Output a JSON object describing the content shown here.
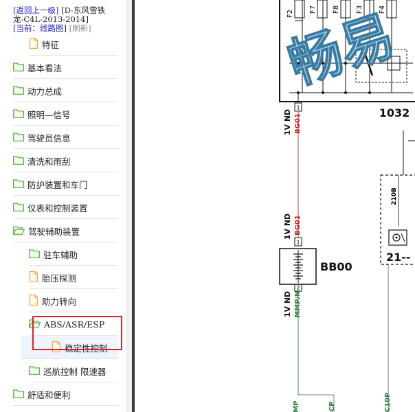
{
  "nav": {
    "back_link": "[返回上一级]",
    "vehicle_line1": "[D-东风雪铁",
    "vehicle_line2": "龙-C4L-2013-2014]",
    "current": "[当前：线路图]",
    "refresh": "[刷新]"
  },
  "tree": {
    "items": [
      {
        "label": "特征",
        "type": "file"
      },
      {
        "label": "基本看法",
        "type": "folder"
      },
      {
        "label": "动力总成",
        "type": "folder"
      },
      {
        "label": "照明—信号",
        "type": "folder"
      },
      {
        "label": "驾驶员信息",
        "type": "folder"
      },
      {
        "label": "清洗和雨刮",
        "type": "folder"
      },
      {
        "label": "防护装置和车门",
        "type": "folder"
      },
      {
        "label": "仪表和控制装置",
        "type": "folder"
      },
      {
        "label": "驾驶辅助装置",
        "type": "folder-open"
      },
      {
        "label": "驻车辅助",
        "type": "folder"
      },
      {
        "label": "胎压探测",
        "type": "file"
      },
      {
        "label": "助力转向",
        "type": "file"
      },
      {
        "label": "ABS/ASR/ESP",
        "type": "folder-open"
      },
      {
        "label": "稳定性控制",
        "type": "file"
      },
      {
        "label": "巡航控制 限速器",
        "type": "folder"
      },
      {
        "label": "舒适和便利",
        "type": "folder"
      }
    ]
  },
  "diagram": {
    "watermark": "畅易",
    "fuse_labels": [
      "F2",
      "F7",
      "F8",
      "F3",
      "F4"
    ],
    "component_1032": "1032",
    "component_bb00": "BB00",
    "component_21": "21--",
    "wire_top_gauge": "1V ND",
    "wire_top_code": "BG01",
    "wire_mid_gauge": "1V ND",
    "wire_mid_code": "BG01",
    "wire_bot_gauge": "1V ND",
    "wire_bot_code": "MMP/N",
    "pin_1": "1",
    "pin_2": "1",
    "pin_3": "2",
    "wire_210b": "210B",
    "bottom_mp": "MP",
    "bottom_cp": "CP",
    "bottom_c10p": "C10P"
  },
  "colors": {
    "folder_green": "#4caf3a",
    "file_orange": "#f0a53a",
    "highlight_red": "#e02020",
    "link_blue": "#1a1acc",
    "wire_red": "#cc2222",
    "wire_green": "#1f7a3a",
    "watermark_blue": "#7ec8e8"
  }
}
